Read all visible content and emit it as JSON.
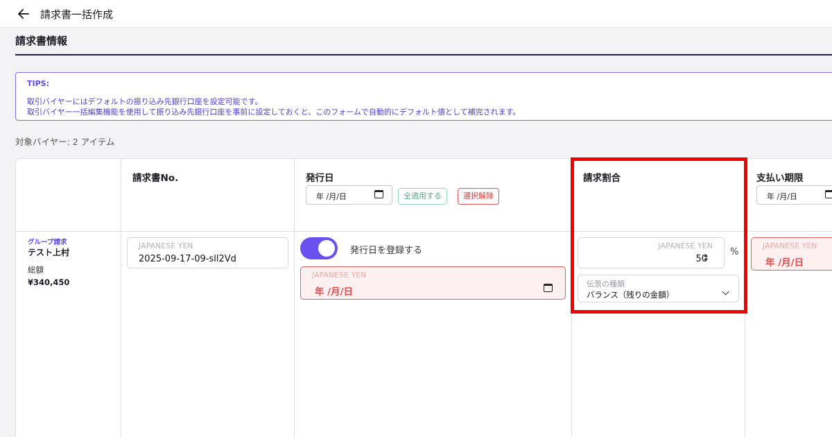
{
  "header": {
    "title": "請求書一括作成"
  },
  "section": {
    "title": "請求書情報"
  },
  "tips": {
    "title": "TIPS:",
    "line1": "取引バイヤーにはデフォルトの振り込み先銀行口座を設定可能です。",
    "line2": "取引バイヤー一括編集機能を使用して振り込み先銀行口座を事前に設定しておくと、このフォームで自動的にデフォルト値として補完されます。"
  },
  "target": {
    "label": "対象バイヤー: 2 アイテム"
  },
  "columns": {
    "invoice_no": "請求書No.",
    "issue_date": "発行日",
    "ratio": "請求割合",
    "due_date": "支払い期限"
  },
  "bulk": {
    "date_placeholder": "年 /月/日",
    "apply_all": "全適用する",
    "clear_selection": "選択解除"
  },
  "row": {
    "group_tag": "グループ請求",
    "buyer_name": "テスト上村",
    "total_label": "総額",
    "total_value": "¥340,450",
    "invoice_no": {
      "caption": "JAPANESE YEN",
      "value": "2025-09-17-09-sll2Vd"
    },
    "register_issue_date": {
      "label": "発行日を登録する",
      "on": true
    },
    "issue_date": {
      "caption": "JAPANESE YEN",
      "value": "年 /月/日"
    },
    "ratio": {
      "caption": "JAPANESE YEN",
      "value": "50",
      "unit": "%"
    },
    "slip_type": {
      "caption": "伝票の種類",
      "value": "バランス（残りの金額）"
    },
    "due_date": {
      "caption": "JAPANESE YEN",
      "value": "年 /月/日"
    }
  },
  "colors": {
    "accent": "#6a50ee",
    "error": "#e14a4a",
    "highlight": "#f20000"
  }
}
